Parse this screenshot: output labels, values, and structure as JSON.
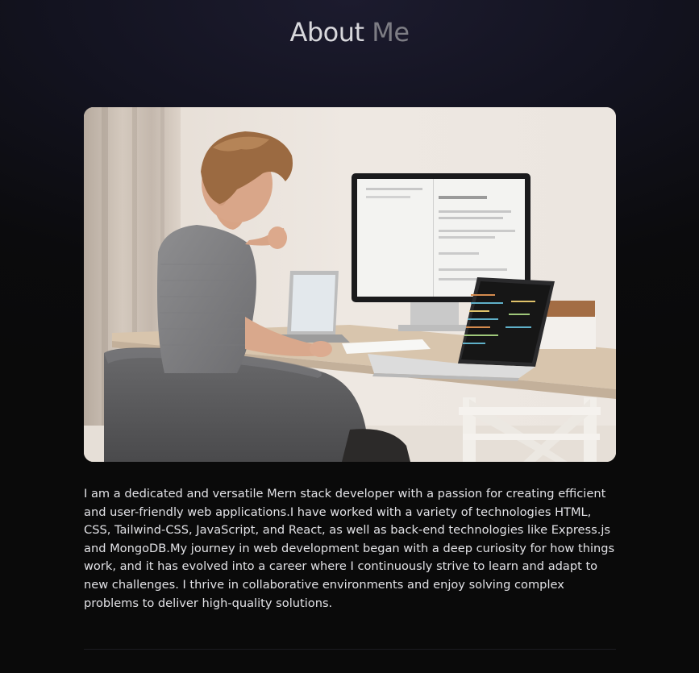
{
  "section": {
    "title_first": "About",
    "title_second": "Me"
  },
  "image": {
    "icon": "portrait-photo"
  },
  "bio": "I am a dedicated and versatile Mern stack developer with a passion for creating efficient and user-friendly web applications.I have worked with a variety of technologies HTML, CSS, Tailwind-CSS, JavaScript, and React, as well as back-end technologies like Express.js and MongoDB.My journey in web development began with a deep curiosity for how things work, and it has evolved into a career where I continuously strive to learn and adapt to new challenges. I thrive in collaborative environments and enjoy solving complex problems to deliver high-quality solutions."
}
